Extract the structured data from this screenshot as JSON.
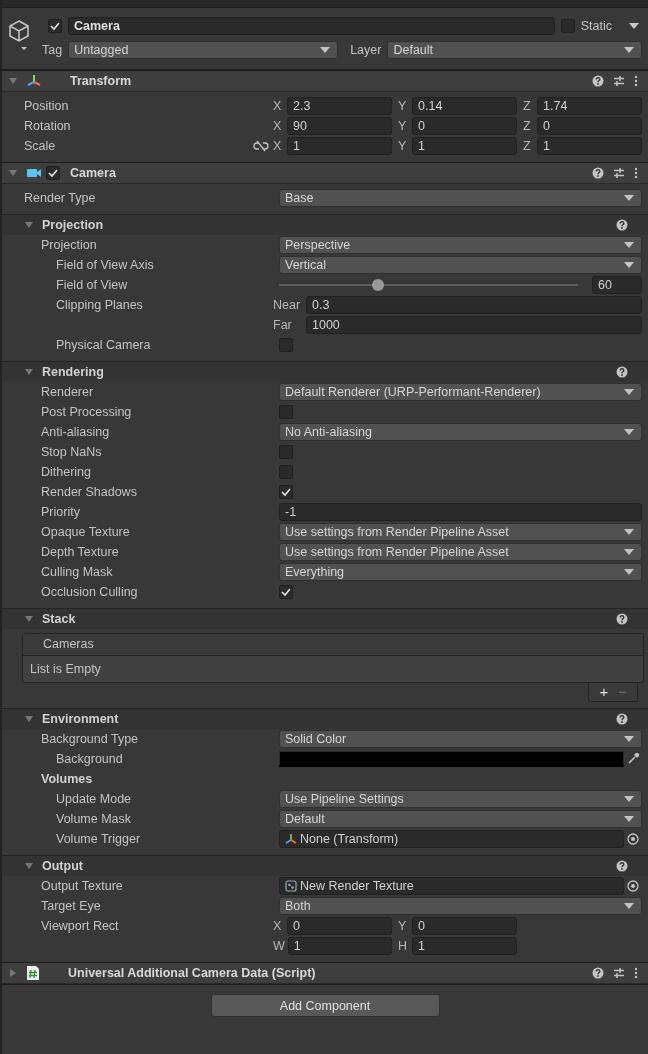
{
  "object": {
    "active": true,
    "name": "Camera",
    "static": false,
    "static_label": "Static",
    "tag_label": "Tag",
    "tag": "Untagged",
    "layer_label": "Layer",
    "layer": "Default"
  },
  "components": [
    {
      "kind": "transform",
      "title": "Transform",
      "expanded": true,
      "rows": [
        {
          "label": "Position",
          "kind": "vector",
          "lines": [
            [
              {
                "axis": "X",
                "value": "2.3"
              },
              {
                "axis": "Y",
                "value": "0.14"
              },
              {
                "axis": "Z",
                "value": "1.74"
              }
            ]
          ]
        },
        {
          "label": "Rotation",
          "kind": "vector",
          "lines": [
            [
              {
                "axis": "X",
                "value": "90"
              },
              {
                "axis": "Y",
                "value": "0"
              },
              {
                "axis": "Z",
                "value": "0"
              }
            ]
          ]
        },
        {
          "label": "Scale",
          "kind": "vector",
          "constrained": false,
          "lines": [
            [
              {
                "axis": "X",
                "value": "1"
              },
              {
                "axis": "Y",
                "value": "1"
              },
              {
                "axis": "Z",
                "value": "1"
              }
            ]
          ]
        }
      ]
    },
    {
      "kind": "camera",
      "title": "Camera",
      "enabled": true,
      "expanded": true,
      "rows": [
        {
          "label": "Render Type",
          "kind": "dropdown",
          "value": "Base"
        }
      ],
      "sections": [
        {
          "title": "Projection",
          "expanded": true,
          "rows": [
            {
              "label": "Projection",
              "kind": "dropdown",
              "value": "Perspective",
              "children": [
                {
                  "label": "Field of View Axis",
                  "kind": "dropdown",
                  "value": "Vertical"
                },
                {
                  "label": "Field of View",
                  "kind": "slider",
                  "level": 0.33,
                  "value": "60"
                },
                {
                  "label": "Clipping Planes",
                  "kind": "vector",
                  "lines": [
                    [
                      {
                        "axis": "Near",
                        "value": "0.3"
                      }
                    ],
                    [
                      {
                        "axis": "Far",
                        "value": "1000"
                      }
                    ]
                  ]
                },
                {
                  "label": "Physical Camera",
                  "kind": "checkbox",
                  "checked": false
                }
              ]
            }
          ]
        },
        {
          "title": "Rendering",
          "expanded": true,
          "rows": [
            {
              "label": "Renderer",
              "kind": "dropdown",
              "value": "Default Renderer (URP-Performant-Renderer)"
            },
            {
              "label": "Post Processing",
              "kind": "checkbox",
              "checked": false
            },
            {
              "label": "Anti-aliasing",
              "kind": "dropdown",
              "value": "No Anti-aliasing"
            },
            {
              "label": "Stop NaNs",
              "kind": "checkbox",
              "checked": false
            },
            {
              "label": "Dithering",
              "kind": "checkbox",
              "checked": false
            },
            {
              "label": "Render Shadows",
              "kind": "checkbox",
              "checked": true
            },
            {
              "label": "Priority",
              "kind": "text",
              "value": "-1"
            },
            {
              "label": "Opaque Texture",
              "kind": "dropdown",
              "value": "Use settings from Render Pipeline Asset"
            },
            {
              "label": "Depth Texture",
              "kind": "dropdown",
              "value": "Use settings from Render Pipeline Asset"
            },
            {
              "label": "Culling Mask",
              "kind": "dropdown",
              "value": "Everything"
            },
            {
              "label": "Occlusion Culling",
              "kind": "checkbox",
              "checked": true
            }
          ]
        },
        {
          "title": "Stack",
          "expanded": true,
          "list": {
            "title": "Cameras",
            "empty_text": "List is Empty",
            "buttons": [
              {
                "label": "+",
                "disabled": false
              },
              {
                "label": "−",
                "disabled": true
              }
            ]
          }
        },
        {
          "title": "Environment",
          "expanded": true,
          "rows": [
            {
              "label": "Background Type",
              "kind": "dropdown",
              "value": "Solid Color",
              "children": [
                {
                  "label": "Background",
                  "kind": "color",
                  "color": "#000000"
                }
              ]
            },
            {
              "label": "Volumes",
              "kind": "heading",
              "children": [
                {
                  "label": "Update Mode",
                  "kind": "dropdown",
                  "value": "Use Pipeline Settings"
                },
                {
                  "label": "Volume Mask",
                  "kind": "dropdown",
                  "value": "Default"
                },
                {
                  "label": "Volume Trigger",
                  "kind": "object",
                  "target": {
                    "kind": "transform",
                    "label": "None (Transform)"
                  }
                }
              ]
            }
          ]
        },
        {
          "title": "Output",
          "expanded": true,
          "rows": [
            {
              "label": "Output Texture",
              "kind": "object",
              "target": {
                "kind": "texture",
                "label": "New Render Texture"
              }
            },
            {
              "label": "Target Eye",
              "kind": "dropdown",
              "value": "Both"
            },
            {
              "label": "Viewport Rect",
              "kind": "vector",
              "lines": [
                [
                  {
                    "axis": "X",
                    "value": "0"
                  },
                  {
                    "axis": "Y",
                    "value": "0"
                  }
                ],
                [
                  {
                    "axis": "W",
                    "value": "1"
                  },
                  {
                    "axis": "H",
                    "value": "1"
                  }
                ]
              ]
            }
          ]
        }
      ]
    },
    {
      "kind": "script",
      "title": "Universal Additional Camera Data (Script)",
      "expanded": false
    }
  ],
  "add_component": "Add Component"
}
